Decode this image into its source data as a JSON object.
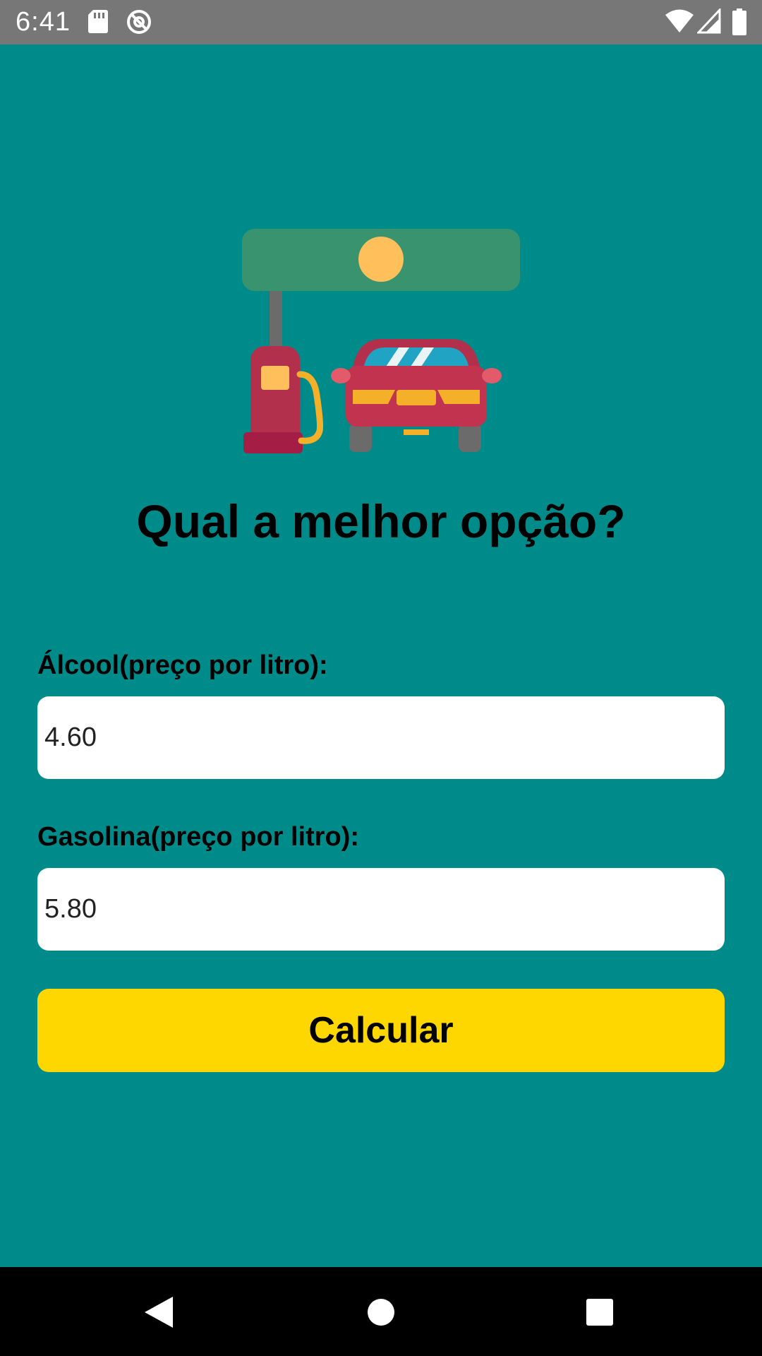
{
  "status_bar": {
    "time": "6:41",
    "icons": [
      "sd-card-icon",
      "no-sync-icon",
      "wifi-icon",
      "cell-signal-icon",
      "battery-icon"
    ]
  },
  "main": {
    "illustration": "gas-station-icon",
    "title": "Qual a melhor opção?",
    "alcool": {
      "label": "Álcool(preço por litro):",
      "value": "4.60"
    },
    "gasolina": {
      "label": "Gasolina(preço por litro):",
      "value": "5.80"
    },
    "button_label": "Calcular"
  },
  "nav_bar": {
    "icons": [
      "back-icon",
      "home-icon",
      "recents-icon"
    ]
  },
  "colors": {
    "background": "#008b8b",
    "button": "#fed700",
    "status_bar": "#777777",
    "nav_bar": "#000000"
  }
}
